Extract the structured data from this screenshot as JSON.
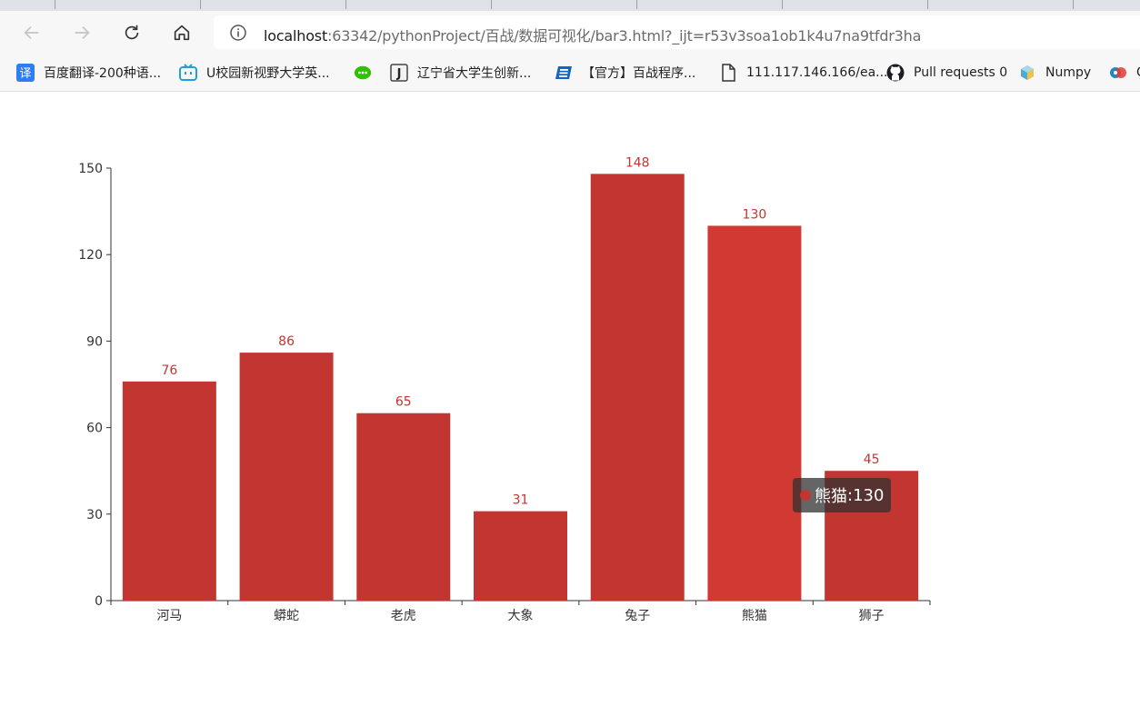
{
  "browser": {
    "url_host": "localhost",
    "url_rest": ":63342/pythonProject/百战/数据可视化/bar3.html?_ijt=r53v3soa1ob1k4u7na9tfdr3ha",
    "bookmarks": [
      {
        "label": "百度翻译-200种语...",
        "icon": "translate-icon"
      },
      {
        "label": "U校园新视野大学英...",
        "icon": "bilibili-icon"
      },
      {
        "label": "",
        "icon": "wechat-icon"
      },
      {
        "label": "辽宁省大学生创新...",
        "icon": "j-icon"
      },
      {
        "label": "【官方】百战程序...",
        "icon": "baizhan-icon"
      },
      {
        "label": "111.117.146.166/ea...",
        "icon": "page-icon"
      },
      {
        "label": "Pull requests 0",
        "icon": "github-icon"
      },
      {
        "label": "Numpy",
        "icon": "numpy-icon"
      },
      {
        "label": "C",
        "icon": "cd-icon"
      }
    ]
  },
  "chart_data": {
    "type": "bar",
    "categories": [
      "河马",
      "蟒蛇",
      "老虎",
      "大象",
      "兔子",
      "熊猫",
      "狮子"
    ],
    "series": [
      {
        "values": [
          76,
          86,
          65,
          31,
          148,
          130,
          45
        ]
      }
    ],
    "ylim": [
      0,
      150
    ],
    "yticks": [
      0,
      30,
      60,
      90,
      120,
      150
    ],
    "data_labels": true,
    "bar_color": "#c23531",
    "highlight_color": "#d13a33",
    "label_color": "#c23531",
    "highlighted_index": 5,
    "tooltip": {
      "name": "熊猫",
      "value": "130"
    }
  }
}
